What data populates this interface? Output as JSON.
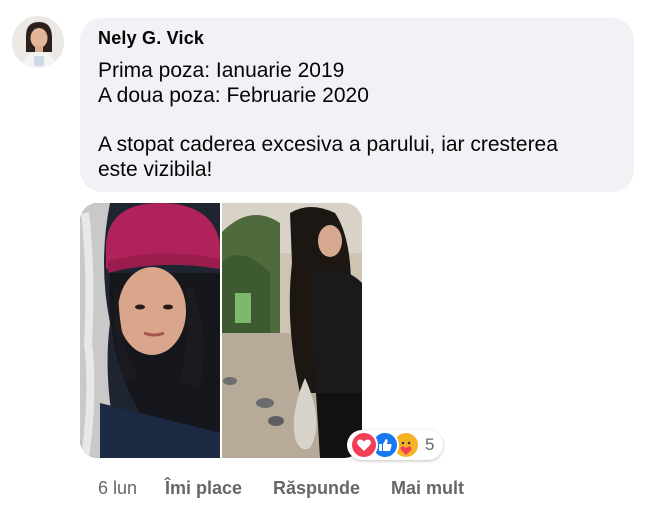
{
  "comment": {
    "author": "Nely G. Vick",
    "lines": [
      "Prima poza: Ianuarie 2019",
      "A doua poza: Februarie 2020",
      "A stopat caderea excesiva a parului, iar cresterea",
      "este vizibila!"
    ]
  },
  "reactions": {
    "icons": [
      "love-icon",
      "like-icon",
      "care-icon"
    ],
    "count": "5"
  },
  "actions": {
    "time": "6 lun",
    "like": "Îmi place",
    "reply": "Răspunde",
    "more": "Mai mult"
  },
  "colors": {
    "bubble": "#f0f2f5",
    "meta_text": "#65676b",
    "like_blue": "#1877f2",
    "love_red": "#f33e58",
    "care_yellow": "#f7b125"
  }
}
